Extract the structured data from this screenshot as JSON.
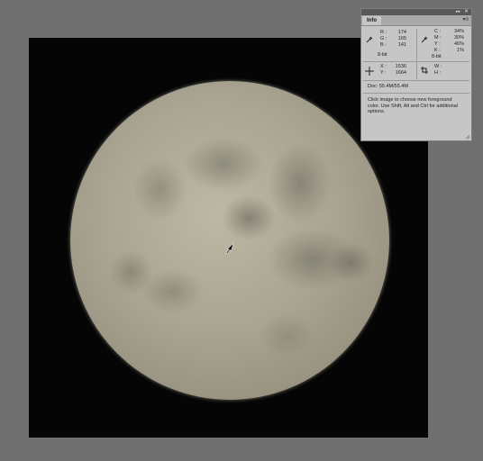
{
  "panel": {
    "tab_label": "Info",
    "rgb": {
      "r_label": "R :",
      "r": "174",
      "g_label": "G :",
      "g": "165",
      "b_label": "B :",
      "b": "141",
      "bit": "8-bit"
    },
    "cmyk": {
      "c_label": "C :",
      "c": "34%",
      "m_label": "M :",
      "m": "30%",
      "y_label": "Y :",
      "y": "46%",
      "k_label": "K :",
      "k": "1%",
      "bit": "8-bit"
    },
    "position": {
      "x_label": "X :",
      "x": "1536",
      "y_label": "Y :",
      "y": "1664"
    },
    "size": {
      "w_label": "W :",
      "h_label": "H :"
    },
    "doc": "Doc: 55.4M/55.4M",
    "hint": "Click image to choose new foreground color.  Use Shift, Alt and Ctrl for additional options."
  },
  "icons": [
    "eyedropper-icon",
    "crosshair-icon",
    "selection-size-icon",
    "arrow-cursor-icon",
    "close-icon",
    "collapse-icon",
    "panel-menu-icon",
    "resize-grip-icon"
  ]
}
